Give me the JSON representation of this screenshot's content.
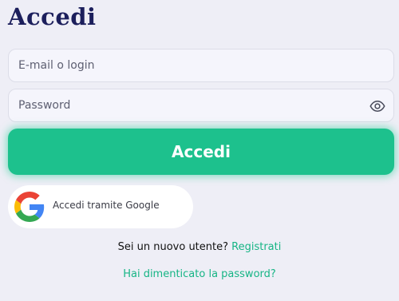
{
  "title": "Accedi",
  "email_field": {
    "placeholder": "E-mail o login",
    "value": ""
  },
  "password_field": {
    "placeholder": "Password",
    "value": ""
  },
  "password_toggle_icon": "eye-icon",
  "login_button": {
    "label": "Accedi",
    "color": "#1dc18d"
  },
  "google_button": {
    "label": "Accedi tramite Google",
    "icon": "google-logo-icon"
  },
  "register": {
    "prompt": "Sei un nuovo utente? ",
    "link_label": "Registrati"
  },
  "forgot_password": {
    "label": "Hai dimenticato la password?"
  },
  "colors": {
    "background": "#eeeef6",
    "title": "#1c1f5c",
    "accent": "#1dc18d",
    "link": "#17b585"
  }
}
